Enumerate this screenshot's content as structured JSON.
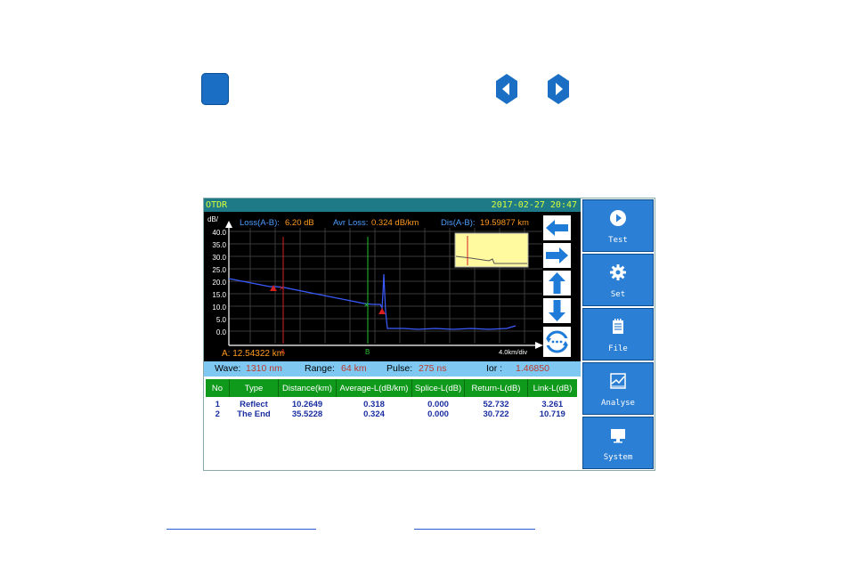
{
  "top": {
    "prev_icon": "arrow-left-icon",
    "next_icon": "arrow-right-icon"
  },
  "otdr": {
    "title": "OTDR",
    "datetime": "2017-02-27 20:47",
    "loss_label": "Loss(A-B):",
    "loss_value": "6.20 dB",
    "avr_loss_label": "Avr Loss:",
    "avr_loss_value": "0.324 dB/km",
    "dis_label": "Dis(A-B):",
    "dis_value": "19.59877 km",
    "y_unit": "dB/",
    "y_ticks": [
      "40.0",
      "35.0",
      "30.0",
      "25.0",
      "20.0",
      "15.0",
      "10.0",
      "5.0",
      "0.0"
    ],
    "marker_a_label": "A",
    "marker_b_label": "B",
    "cursor_readout": "A: 12.54322 km",
    "scale": "4.0km/div",
    "info": {
      "wave_label": "Wave:",
      "wave_value": "1310 nm",
      "range_label": "Range:",
      "range_value": "64 km",
      "pulse_label": "Pulse:",
      "pulse_value": "275 ns",
      "ior_label": "Ior :",
      "ior_value": "1.46850"
    },
    "table": {
      "headers": [
        "No",
        "Type",
        "Distance(km)",
        "Average-L(dB/km)",
        "Splice-L(dB)",
        "Return-L(dB)",
        "Link-L(dB)"
      ],
      "rows": [
        [
          "1",
          "Reflect",
          "10.2649",
          "0.318",
          "0.000",
          "52.732",
          "3.261"
        ],
        [
          "2",
          "The End",
          "35.5228",
          "0.324",
          "0.000",
          "30.722",
          "10.719"
        ]
      ]
    },
    "arrow_icons": [
      "arrow-left-icon",
      "arrow-right-icon",
      "arrow-up-icon",
      "arrow-down-icon",
      "refresh-icon"
    ]
  },
  "side_menu": [
    {
      "label": "Test",
      "icon": "play-icon"
    },
    {
      "label": "Set",
      "icon": "gear-icon"
    },
    {
      "label": "File",
      "icon": "document-icon"
    },
    {
      "label": "Analyse",
      "icon": "chart-icon"
    },
    {
      "label": "System",
      "icon": "monitor-icon"
    }
  ]
}
